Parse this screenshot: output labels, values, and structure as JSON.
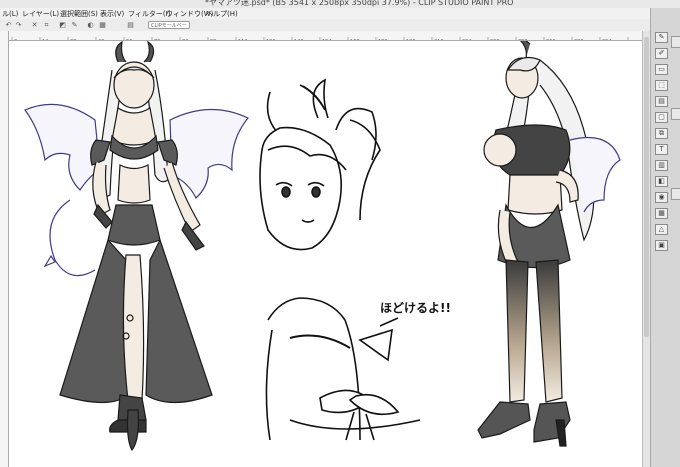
{
  "window": {
    "title": "*ヤマアツ迷.psd* (B5 3541 x 2508px 350dpi 37.9%) - CLIP STUDIO PAINT PRO"
  },
  "menu": [
    {
      "label": "ル(L)"
    },
    {
      "label": "レイヤー(L)"
    },
    {
      "label": "選択範囲(S)"
    },
    {
      "label": "表示(V)"
    },
    {
      "label": "フィルター(I)"
    },
    {
      "label": "ウィンドウ(W)"
    },
    {
      "label": "ヘルプ(H)"
    }
  ],
  "toolbar": {
    "items": [
      "undo-icon",
      "redo-icon",
      "clear-icon",
      "transform-icon",
      "fill-icon",
      "eyedropper-icon",
      "palette-icon",
      "grid-icon",
      "layer-icon"
    ],
    "shortcut_pill": "CLIPモールベータ"
  },
  "ruler": {
    "ticks": [
      "0",
      "14",
      "28",
      "42",
      "56",
      "70",
      "84",
      "98",
      "112",
      "126",
      "140",
      "154",
      "168",
      "182",
      "196",
      "210",
      "224",
      "238",
      "252",
      "266",
      "280",
      "294"
    ]
  },
  "canvas": {
    "annotation": "ほどけるよ!!"
  },
  "rightpanel": {
    "buttons": [
      "brush-icon",
      "pen-icon",
      "eraser-icon",
      "select-icon",
      "layer-icon",
      "folder-icon",
      "copy-icon",
      "text-icon",
      "ruler-icon",
      "gradient-icon",
      "color-icon",
      "mesh-icon",
      "shape-icon",
      "frame-icon"
    ]
  },
  "colors": {
    "ink": "#1a1a1a",
    "fill_grey": "#5a5a5a",
    "skin": "#f3ebe1",
    "wing_lines": "#3d3b8a",
    "gradient_skin": "#dccbb2"
  }
}
